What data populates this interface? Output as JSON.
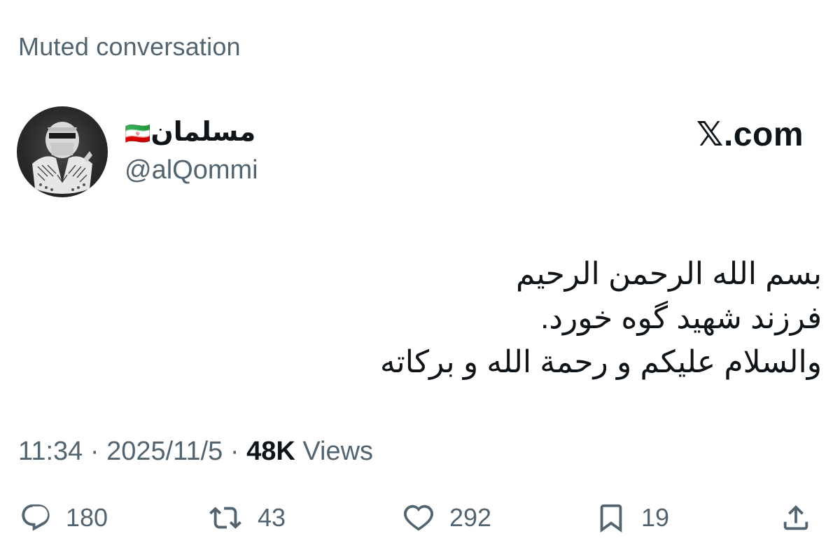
{
  "header": {
    "muted_label": "Muted conversation",
    "brand": "𝕏.com"
  },
  "author": {
    "display_name": "مسلمان",
    "name_suffix_emoji": "🇮🇷",
    "handle": "@alQommi",
    "avatar_icon": "keffiyeh-masked-figure-avatar"
  },
  "tweet": {
    "lines": [
      "بسم الله الرحمن الرحیم",
      "فرزند شهید گوه خورد.",
      "والسلام علیکم و رحمة الله و برکاته"
    ]
  },
  "meta": {
    "time": "11:34",
    "separator": " · ",
    "date": "2025/11/5",
    "views_count": "48K",
    "views_label": "Views"
  },
  "actions": {
    "reply": {
      "icon": "reply-bubble-icon",
      "count": "180"
    },
    "repost": {
      "icon": "repost-arrows-icon",
      "count": "43"
    },
    "like": {
      "icon": "heart-icon",
      "count": "292"
    },
    "bookmark": {
      "icon": "bookmark-icon",
      "count": "19"
    },
    "share": {
      "icon": "share-upload-icon"
    }
  },
  "colors": {
    "text_primary": "#0f1419",
    "text_secondary": "#536471",
    "background": "#ffffff"
  }
}
